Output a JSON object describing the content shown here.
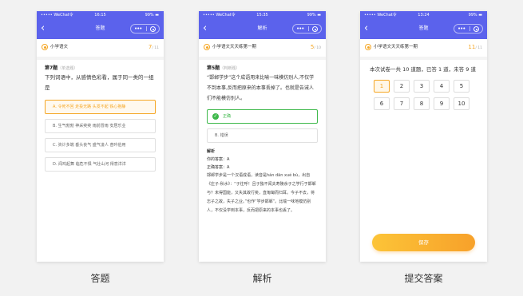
{
  "phones": [
    {
      "status": {
        "carrier": "••••• WeChat令",
        "time": "16:15",
        "battery": "99% ▬"
      },
      "nav": {
        "title": "答题",
        "back": "‹",
        "menu": "•••"
      },
      "subhead": {
        "name": "小学语文",
        "current": "7",
        "total": "/ 11"
      },
      "question": {
        "number": "第7题",
        "type": "（单选题）",
        "text": "下列词语中，从感情色彩看，属于同一类的一组是",
        "options": [
          {
            "label": "A. 令死不回 走投无路 头发不起 铁心抱静",
            "state": "selected"
          },
          {
            "label": "B. 生气勃勃 神采奕奕 雨前冒雨 安居乐业",
            "state": "normal"
          },
          {
            "label": "C. 资计多端 垂头丧气 盛气凌人 奋吟伯用",
            "state": "normal"
          },
          {
            "label": "D. 闻鸡起舞 临危不惧 气壮山河 得意洋洋",
            "state": "normal"
          }
        ]
      },
      "caption": "答题"
    },
    {
      "status": {
        "carrier": "••••• WeChat令",
        "time": "15:35",
        "battery": "99% ▬"
      },
      "nav": {
        "title": "解析",
        "back": "‹",
        "menu": "•••"
      },
      "subhead": {
        "name": "小学语文天天练第一期",
        "current": "5",
        "total": "/ 10"
      },
      "question": {
        "number": "第5题",
        "type": "（判断题）",
        "text": "“邯郸学步”这个成语用来比喻一味模仿别人,不仅学不到本事,反而把原来的本事丢掉了。也就是告诫人们不能模仿别人。",
        "options": [
          {
            "label": "正确",
            "state": "correct"
          },
          {
            "label": "B. 错误",
            "state": "normal"
          }
        ]
      },
      "analysis": {
        "heading": "解析",
        "your_answer": "你的答案：A",
        "correct_answer": "正确答案：A",
        "body": "邯郸学步是一个汉语成语，读音是hán dān xué bù，出自《庄子·秋水》：“子往呼！且子独不闻夫寿陵余子之学行于邯郸与？未得国能，又失其故行矣，直匍匐而归耳。今子不去，将忘子之故，失子之业。”也作“学步邯郸”。比喻一味地模仿别人，不仅没学到本事，反而把原来的本事也丢了。"
      },
      "caption": "解析"
    },
    {
      "status": {
        "carrier": "••••• WeChat令",
        "time": "13:24",
        "battery": "99% ▬"
      },
      "nav": {
        "title": "答题",
        "back": "‹",
        "menu": "•••"
      },
      "subhead": {
        "name": "小学语文天天练第一期",
        "current": "11",
        "total": "/ 11"
      },
      "summary": "本次试卷一共 10 道题，已答 1 道，未答 9 道",
      "numbers": [
        "1",
        "2",
        "3",
        "4",
        "5",
        "6",
        "7",
        "8",
        "9",
        "10"
      ],
      "submit_label": "保存",
      "caption": "提交答案"
    }
  ],
  "colors": {
    "accent": "#5b62ec",
    "orange": "#f5a623",
    "green": "#3db84a"
  }
}
